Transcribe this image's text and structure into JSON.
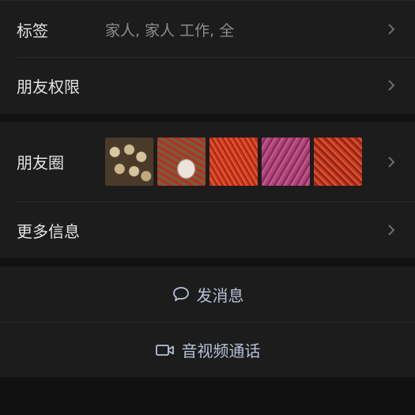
{
  "rows": {
    "tags": {
      "label": "标签",
      "value": "家人, 家人 工作, 全"
    },
    "permissions": {
      "label": "朋友权限"
    },
    "moments": {
      "label": "朋友圈",
      "thumbnails": [
        "photo-potatoes",
        "photo-chili-bowl",
        "photo-red-chilies",
        "photo-pink-chilies",
        "photo-chilies-2"
      ]
    },
    "more": {
      "label": "更多信息"
    }
  },
  "actions": {
    "message": {
      "label": "发消息",
      "icon": "chat-bubble-icon"
    },
    "call": {
      "label": "音视频通话",
      "icon": "video-camera-icon"
    }
  },
  "colors": {
    "background": "#111111",
    "panel": "#1c1c1c",
    "action_text": "#b7c1d9",
    "muted_text": "#8c8c8c"
  }
}
